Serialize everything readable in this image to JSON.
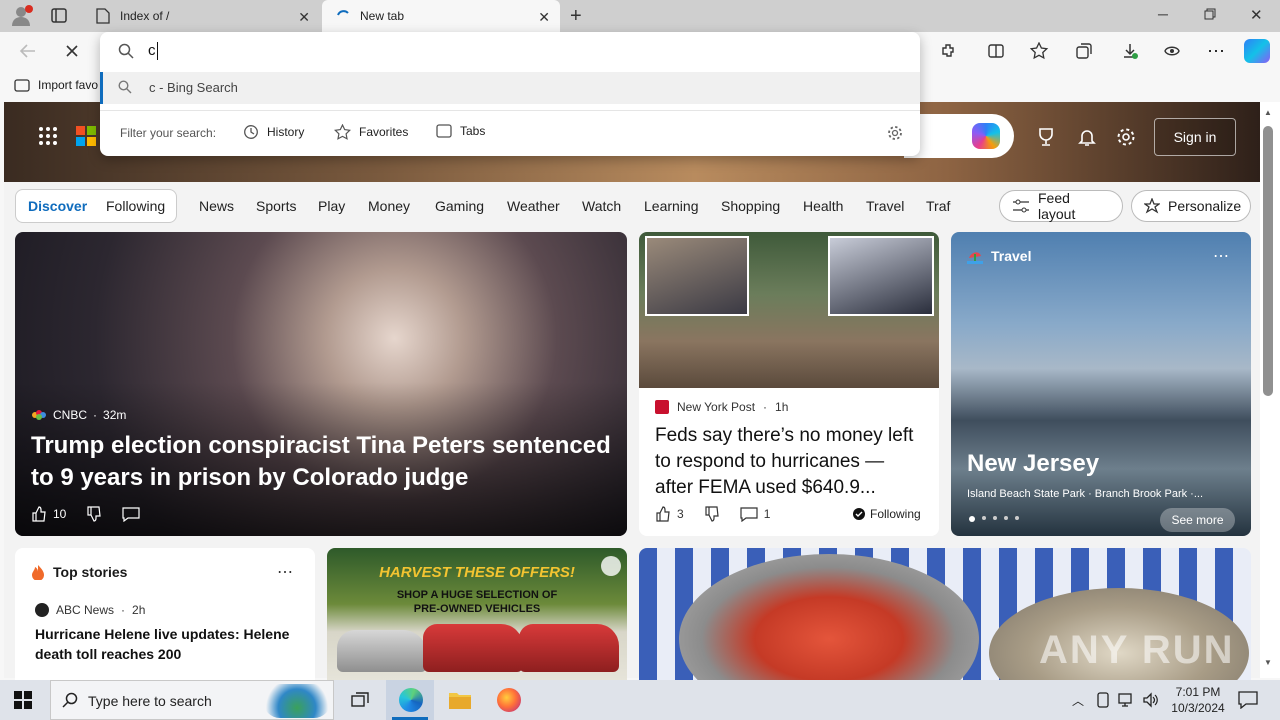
{
  "tabs": [
    {
      "title": "Index of /"
    },
    {
      "title": "New tab"
    }
  ],
  "favorites_bar": {
    "import_label": "Import favo"
  },
  "address_bar": {
    "value": "c"
  },
  "suggestion": {
    "text": "c - Bing Search"
  },
  "filter": {
    "label": "Filter your search:",
    "chips": [
      "History",
      "Favorites",
      "Tabs"
    ]
  },
  "header": {
    "sign_in": "Sign in"
  },
  "nav": {
    "items": [
      "Discover",
      "Following",
      "News",
      "Sports",
      "Play",
      "Money",
      "Gaming",
      "Weather",
      "Watch",
      "Learning",
      "Shopping",
      "Health",
      "Travel",
      "Traf"
    ],
    "feed_layout": "Feed layout",
    "personalize": "Personalize"
  },
  "lead_story": {
    "source": "CNBC",
    "age": "32m",
    "headline": "Trump election conspiracist Tina Peters sentenced to 9 years in prison by Colorado judge",
    "likes": "10"
  },
  "story2": {
    "source": "New York Post",
    "age": "1h",
    "headline": "Feds say there’s no money left to respond to hurricanes — after FEMA used $640.9...",
    "likes": "3",
    "comments": "1",
    "following": "Following"
  },
  "travel": {
    "label": "Travel",
    "title": "New Jersey",
    "subtitle": "Island Beach State Park · Branch Brook Park ·...",
    "see_more": "See more"
  },
  "top_stories": {
    "title": "Top stories",
    "source": "ABC News",
    "age": "2h",
    "headline": "Hurricane Helene live updates: Helene death toll reaches 200"
  },
  "ad": {
    "line1": "HARVEST THESE OFFERS!",
    "line2": "SHOP A HUGE SELECTION OF",
    "line3": "PRE-OWNED VEHICLES"
  },
  "watermark": "ANY RUN",
  "taskbar": {
    "search_placeholder": "Type here to search",
    "time": "7:01 PM",
    "date": "10/3/2024"
  },
  "colors": {
    "accent": "#0f6cbd",
    "tabstrip": "#cfcfcf"
  }
}
